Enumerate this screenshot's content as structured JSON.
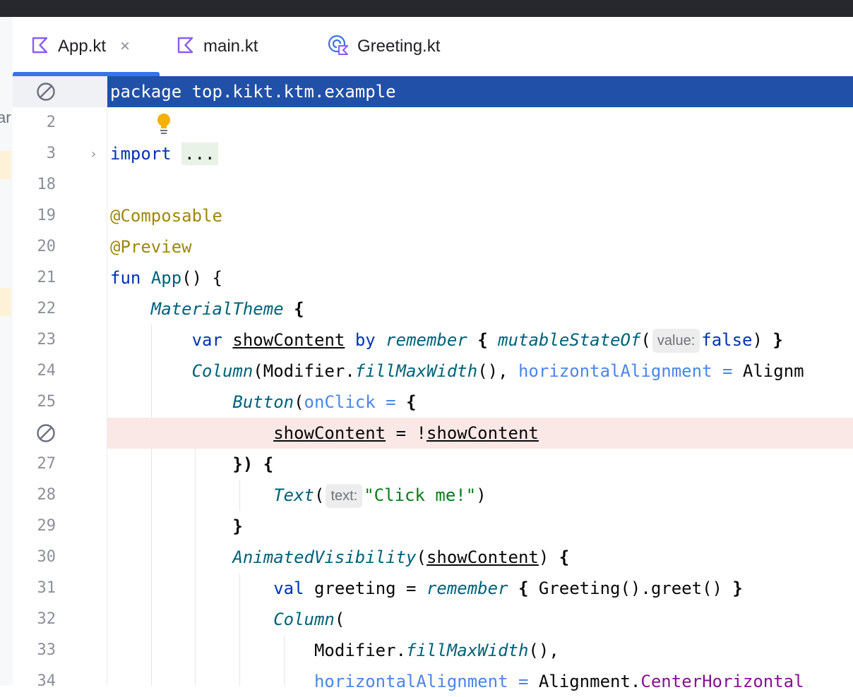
{
  "tabs": [
    {
      "label": "App.kt",
      "icon": "kotlin-file-icon",
      "active": true,
      "closable": true
    },
    {
      "label": "main.kt",
      "icon": "kotlin-file-icon",
      "active": false,
      "closable": false
    },
    {
      "label": "Greeting.kt",
      "icon": "kotlin-class-icon",
      "active": false,
      "closable": false
    }
  ],
  "left_strip_text": "ar",
  "colors": {
    "accent": "#3574f0",
    "selection": "#2150a8",
    "breakpoint_line": "#fae8e6",
    "keyword": "#0033b3",
    "function": "#00627a",
    "annotation": "#9e880d",
    "string": "#067d17"
  },
  "editor": {
    "line_numbers": [
      "2",
      "3",
      "18",
      "19",
      "20",
      "21",
      "22",
      "23",
      "24",
      "25",
      "27",
      "28",
      "29",
      "30",
      "31",
      "32",
      "33",
      "34"
    ],
    "hints": {
      "value": "value:",
      "text": "text:"
    },
    "lines": {
      "l1": [
        "package top.kikt.ktm.example"
      ],
      "l3": [
        "import",
        " ",
        "..."
      ],
      "l19": [
        "@Composable"
      ],
      "l20": [
        "@Preview"
      ],
      "l21": [
        "fun",
        " ",
        "App",
        "() {"
      ],
      "l22": [
        "    ",
        "MaterialTheme",
        " ",
        "{"
      ],
      "l23": [
        "        ",
        "var",
        " ",
        "showContent",
        " ",
        "by",
        " ",
        "remember",
        " ",
        "{",
        " ",
        "mutableStateOf",
        "(",
        "false",
        ") ",
        "}"
      ],
      "l24": [
        "        ",
        "Column",
        "(Modifier.",
        "fillMaxWidth",
        "(), ",
        "horizontalAlignment",
        " ",
        "=",
        " ",
        "Alignm"
      ],
      "l25": [
        "            ",
        "Button",
        "(",
        "onClick",
        " ",
        "=",
        " ",
        "{"
      ],
      "l26": [
        "                ",
        "showContent",
        " = !",
        "showContent"
      ],
      "l27": [
        "            ",
        "}) {"
      ],
      "l28": [
        "                ",
        "Text",
        "(",
        "\"Click me!\"",
        ")"
      ],
      "l29": [
        "            ",
        "}"
      ],
      "l30": [
        "            ",
        "AnimatedVisibility",
        "(",
        "showContent",
        ") ",
        "{"
      ],
      "l31": [
        "                ",
        "val",
        " greeting = ",
        "remember",
        " ",
        "{",
        " Greeting().greet() ",
        "}"
      ],
      "l32": [
        "                ",
        "Column",
        "("
      ],
      "l33": [
        "                    Modifier.",
        "fillMaxWidth",
        "(),"
      ],
      "l34": [
        "                    ",
        "horizontalAlignment",
        " ",
        "=",
        " Alignment.",
        "CenterHorizontal"
      ]
    }
  }
}
